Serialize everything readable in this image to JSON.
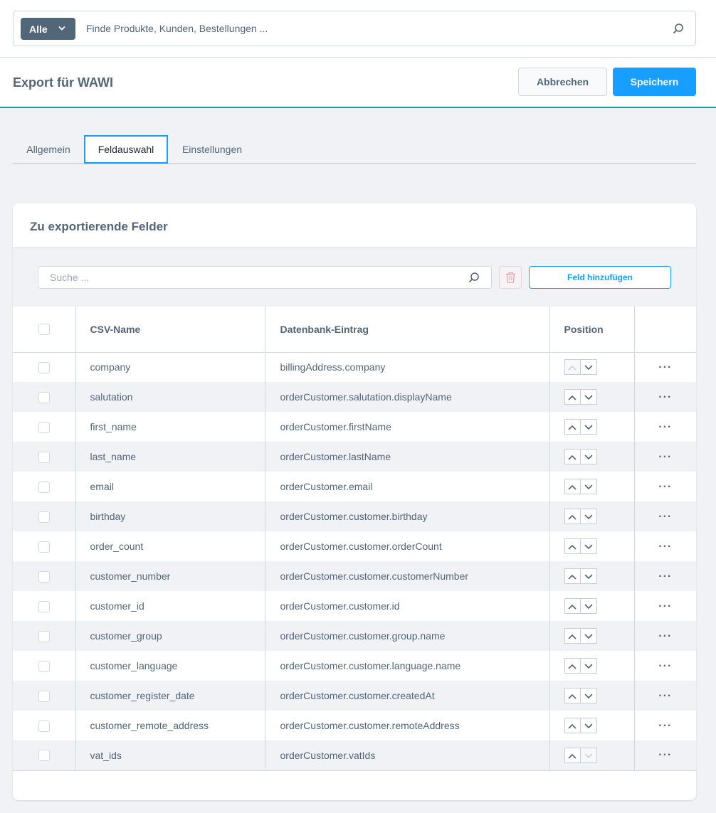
{
  "topbar": {
    "search_type": "Alle",
    "search_placeholder": "Finde Produkte, Kunden, Bestellungen ..."
  },
  "header": {
    "title": "Export für WAWI",
    "cancel_label": "Abbrechen",
    "save_label": "Speichern"
  },
  "tabs": [
    {
      "label": "Allgemein",
      "active": false
    },
    {
      "label": "Feldauswahl",
      "active": true
    },
    {
      "label": "Einstellungen",
      "active": false
    }
  ],
  "card": {
    "title": "Zu exportierende Felder",
    "search_placeholder": "Suche ...",
    "add_label": "Feld hinzufügen"
  },
  "grid": {
    "columns": [
      "CSV-Name",
      "Datenbank-Eintrag",
      "Position"
    ],
    "rows": [
      {
        "csv": "company",
        "db": "billingAddress.company"
      },
      {
        "csv": "salutation",
        "db": "orderCustomer.salutation.displayName"
      },
      {
        "csv": "first_name",
        "db": "orderCustomer.firstName"
      },
      {
        "csv": "last_name",
        "db": "orderCustomer.lastName"
      },
      {
        "csv": "email",
        "db": "orderCustomer.email"
      },
      {
        "csv": "birthday",
        "db": "orderCustomer.customer.birthday"
      },
      {
        "csv": "order_count",
        "db": "orderCustomer.customer.orderCount"
      },
      {
        "csv": "customer_number",
        "db": "orderCustomer.customer.customerNumber"
      },
      {
        "csv": "customer_id",
        "db": "orderCustomer.customer.id"
      },
      {
        "csv": "customer_group",
        "db": "orderCustomer.customer.group.name"
      },
      {
        "csv": "customer_language",
        "db": "orderCustomer.customer.language.name"
      },
      {
        "csv": "customer_register_date",
        "db": "orderCustomer.customer.createdAt"
      },
      {
        "csv": "customer_remote_address",
        "db": "orderCustomer.customer.remoteAddress"
      },
      {
        "csv": "vat_ids",
        "db": "orderCustomer.vatIds"
      }
    ],
    "actions_label": "···"
  },
  "colors": {
    "primary": "#189eff",
    "accent_line": "#189eac",
    "text": "#52667a",
    "border": "#d1d9e0"
  }
}
